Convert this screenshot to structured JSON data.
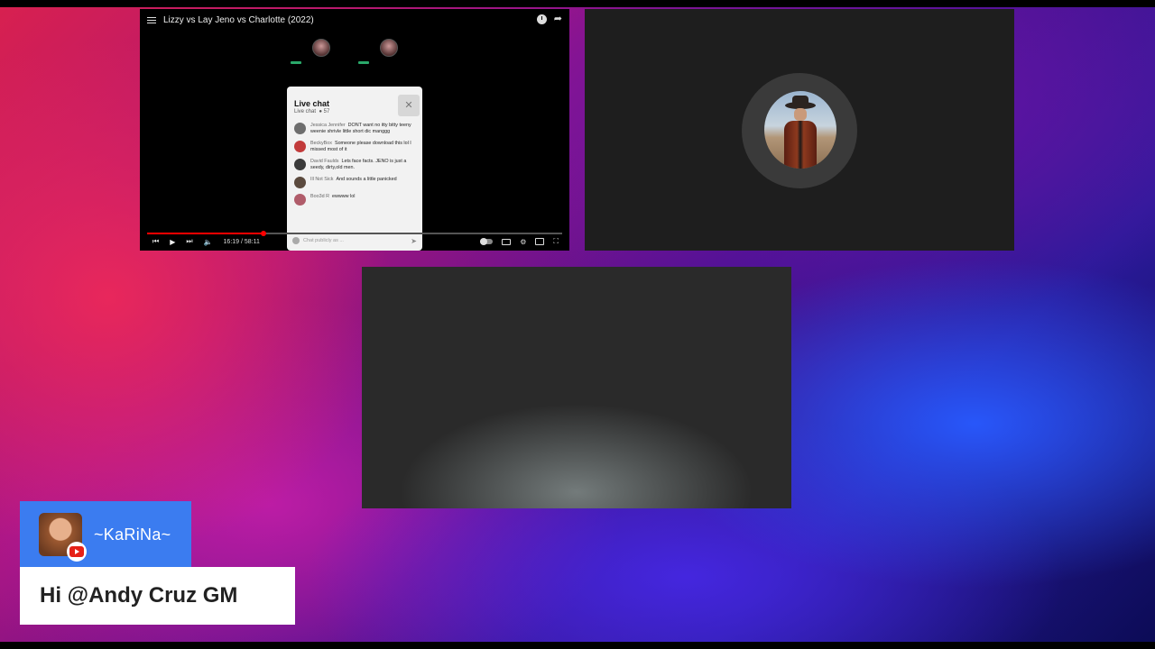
{
  "video": {
    "title": "Lizzy vs Lay Jeno vs Charlotte (2022)",
    "time": "16:19 / 58:11",
    "progress": 0.28,
    "icons": [
      "menu-icon",
      "watch-later-icon",
      "share-icon",
      "prev-icon",
      "play-icon",
      "next-icon",
      "volume-icon",
      "autoplay-toggle",
      "captions-icon",
      "settings-icon",
      "cast-icon",
      "fullscreen-icon"
    ]
  },
  "live_chat": {
    "title": "Live chat",
    "subtitle": "Live chat",
    "viewer_count": "57",
    "messages": [
      {
        "author": "Jessica Jennifer",
        "text": "DONT want no itty bitty teeny weenie shrivle little short dic manggg"
      },
      {
        "author": "BeckyBox",
        "text": "Someone please download this lol I missed most of it"
      },
      {
        "author": "David Faulds",
        "text": "Lets face facts. JENO is just a seedy, dirty,old men."
      },
      {
        "author": "Ill Not Sick",
        "text": "And sounds a little panicked"
      },
      {
        "author": "Boo3d R",
        "text": "ewwww lol"
      }
    ],
    "input_placeholder": "Chat publicly as ..."
  },
  "overlay_comment": {
    "author": "~KaRiNa~",
    "text": "Hi @Andy Cruz GM",
    "author_bg": "#3b7cf0",
    "platform_icon": "youtube-icon"
  }
}
